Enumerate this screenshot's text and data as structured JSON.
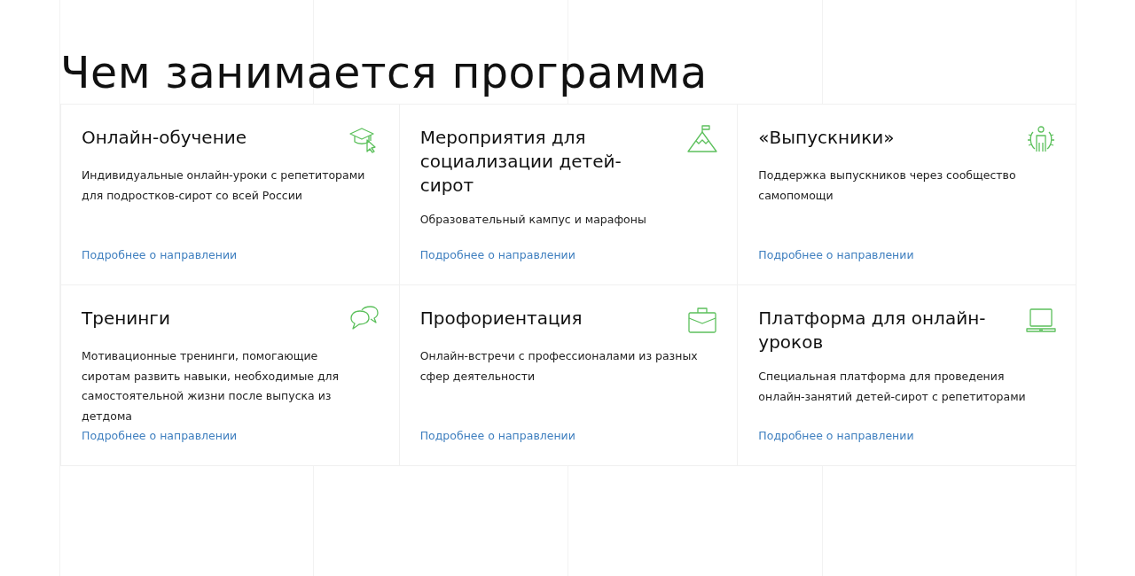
{
  "heading": "Чем занимается программа",
  "cards": [
    {
      "title": "Онлайн-обучение",
      "text": "Индивидуальные онлайн-уроки с репетиторами для подростков-сирот со всей России",
      "link": "Подробнее о направлении",
      "kind": "education"
    },
    {
      "title": "Мероприятия для социализации детей-сирот",
      "text": "Образовательный кампус и марафоны",
      "link": "Подробнее о направлении",
      "kind": "mountain"
    },
    {
      "title": "«Выпускники»",
      "text": "Поддержка выпускников через сообщество самопомощи",
      "link": "Подробнее о направлении",
      "kind": "person"
    },
    {
      "title": "Тренинги",
      "text": "Мотивационные тренинги, помогающие сиротам развить навыки, необходимые для самостоятельной жизни после выпуска из детдома",
      "link": "Подробнее о направлении",
      "kind": "chat"
    },
    {
      "title": "Профориентация",
      "text": "Онлайн-встречи с профессионалами из разных сфер деятельности",
      "link": "Подробнее о направлении",
      "kind": "briefcase"
    },
    {
      "title": "Платформа для онлайн-уроков",
      "text": "Специальная платформа для проведения онлайн-занятий детей-сирот с репетиторами",
      "link": "Подробнее о направлении",
      "kind": "laptop"
    }
  ]
}
